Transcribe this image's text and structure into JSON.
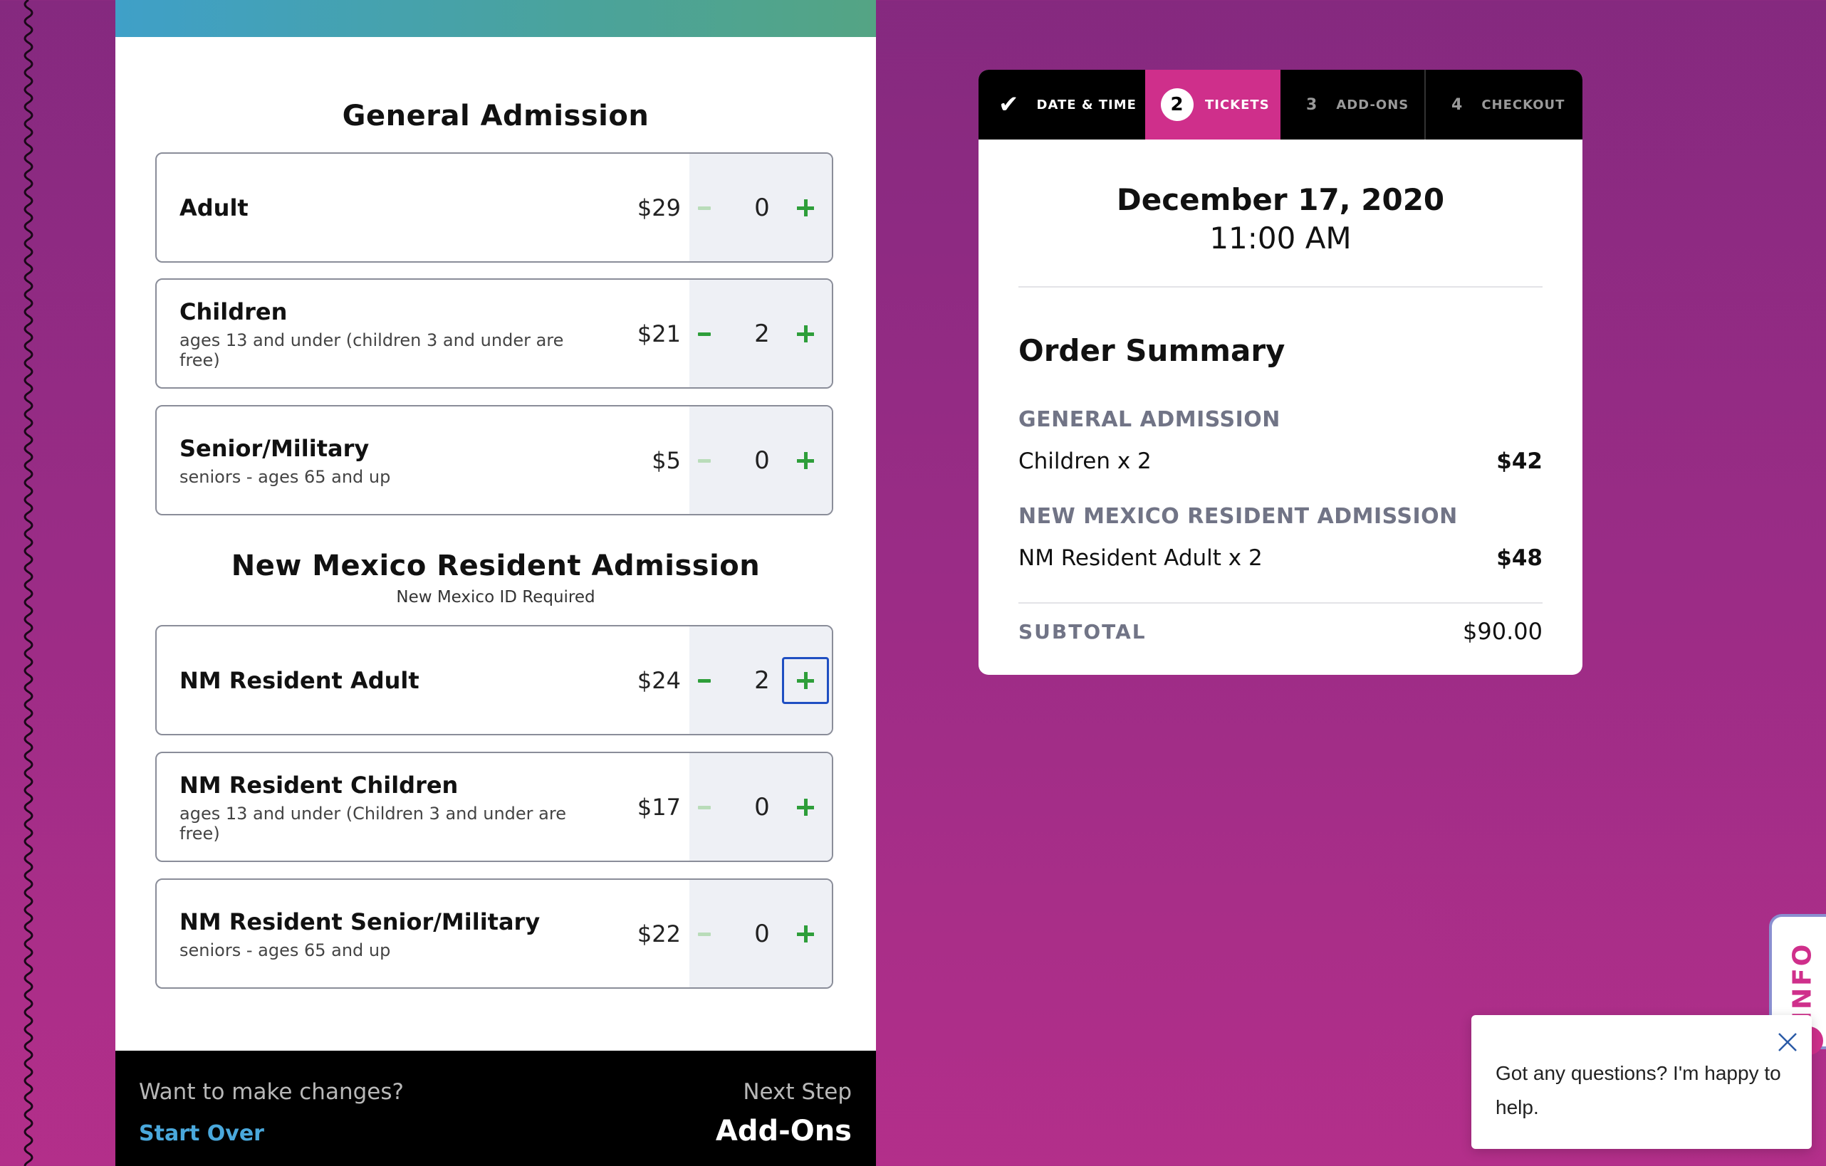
{
  "general": {
    "title": "General Admission",
    "tickets": [
      {
        "name": "Adult",
        "desc": "",
        "price": "$29",
        "qty": "0",
        "minus_enabled": false
      },
      {
        "name": "Children",
        "desc": "ages 13 and under (children 3 and under are free)",
        "price": "$21",
        "qty": "2",
        "minus_enabled": true
      },
      {
        "name": "Senior/Military",
        "desc": "seniors - ages 65 and up",
        "price": "$5",
        "qty": "0",
        "minus_enabled": false
      }
    ]
  },
  "resident": {
    "title": "New Mexico Resident Admission",
    "subtitle": "New Mexico ID Required",
    "tickets": [
      {
        "name": "NM Resident Adult",
        "desc": "",
        "price": "$24",
        "qty": "2",
        "minus_enabled": true
      },
      {
        "name": "NM Resident Children",
        "desc": "ages 13 and under (Children 3 and under are free)",
        "price": "$17",
        "qty": "0",
        "minus_enabled": false
      },
      {
        "name": "NM Resident Senior/Military",
        "desc": "seniors - ages 65 and up",
        "price": "$22",
        "qty": "0",
        "minus_enabled": false
      }
    ]
  },
  "footer": {
    "question": "Want to make changes?",
    "start_over": "Start Over",
    "next_label": "Next Step",
    "next_step": "Add-Ons"
  },
  "steps": [
    {
      "marker": "✔",
      "label": "DATE & TIME",
      "state": "done"
    },
    {
      "marker": "2",
      "label": "TICKETS",
      "state": "current"
    },
    {
      "marker": "3",
      "label": "ADD-ONS",
      "state": "upcoming"
    },
    {
      "marker": "4",
      "label": "CHECKOUT",
      "state": "upcoming"
    }
  ],
  "order": {
    "date": "December 17, 2020",
    "time": "11:00 AM",
    "summary_title": "Order Summary",
    "groups": [
      {
        "category": "GENERAL ADMISSION",
        "item": "Children x 2",
        "amount": "$42"
      },
      {
        "category": "NEW MEXICO RESIDENT ADMISSION",
        "item": "NM Resident Adult x 2",
        "amount": "$48"
      }
    ],
    "subtotal_label": "SUBTOTAL",
    "subtotal_value": "$90.00"
  },
  "info_tab": {
    "label": "INFO"
  },
  "chat": {
    "message": "Got any questions? I'm happy to help."
  },
  "colors": {
    "accent_pink": "#cf2f8b",
    "plus_green": "#2e9e3a",
    "link_blue": "#4aa8dc",
    "focus_blue": "#1f4fc2"
  }
}
